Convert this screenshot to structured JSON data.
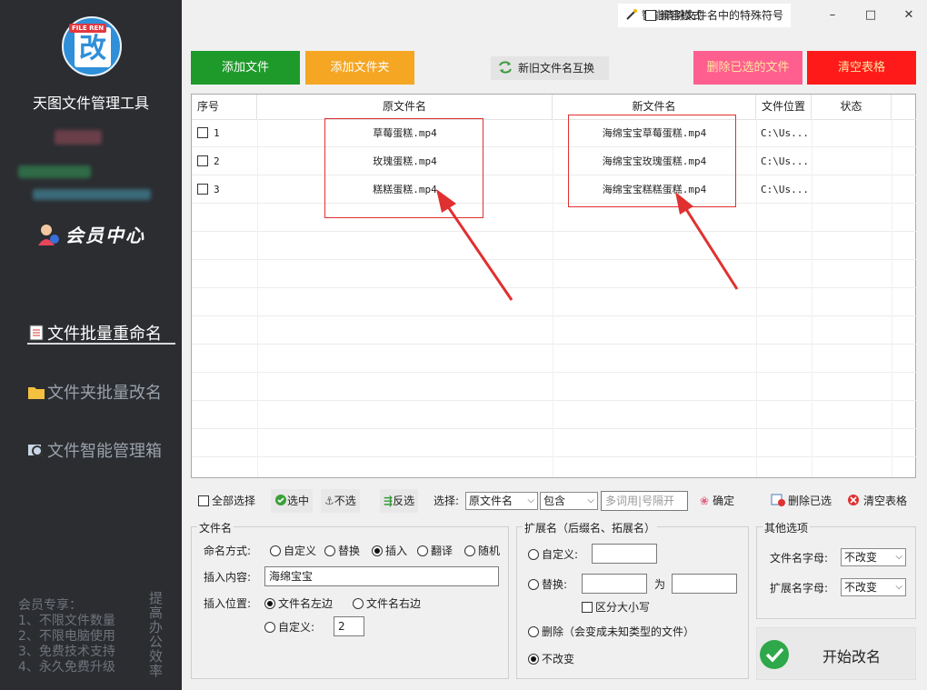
{
  "sidebar": {
    "app_title": "天图文件管理工具",
    "logo_tag": "FILE REN",
    "logo_char": "改",
    "member_center": "会员中心",
    "nav": [
      {
        "label": "文件批量重命名",
        "active": true
      },
      {
        "label": "文件夹批量改名",
        "active": false
      },
      {
        "label": "文件智能管理箱",
        "active": false
      }
    ],
    "perks": [
      "会员专享：",
      "1、不限文件数量",
      "2、不限电脑使用",
      "3、免费技术支持",
      "4、永久免费升级"
    ],
    "perks_vertical": "提高办公效率"
  },
  "titlebar": {
    "promo": "智能清除文件名中的特殊符号",
    "compat_mode": "兼容模式",
    "minimize": "–",
    "maximize": "□",
    "close": "✕"
  },
  "actions": {
    "add_file": "添加文件",
    "add_folder": "添加文件夹",
    "swap_names": "新旧文件名互换",
    "delete_selected": "删除已选的文件",
    "clear_table": "清空表格"
  },
  "table": {
    "headers": [
      "序号",
      "原文件名",
      "新文件名",
      "文件位置",
      "状态"
    ],
    "rows": [
      {
        "index": "1",
        "original": "草莓蛋糕.mp4",
        "new": "海绵宝宝草莓蛋糕.mp4",
        "location": "C:\\Us...",
        "status": ""
      },
      {
        "index": "2",
        "original": "玫瑰蛋糕.mp4",
        "new": "海绵宝宝玫瑰蛋糕.mp4",
        "location": "C:\\Us...",
        "status": ""
      },
      {
        "index": "3",
        "original": "糕糕蛋糕.mp4",
        "new": "海绵宝宝糕糕蛋糕.mp4",
        "location": "C:\\Us...",
        "status": ""
      }
    ]
  },
  "selection_bar": {
    "select_all": "全部选择",
    "select": "选中",
    "unselect": "不选",
    "invert": "反选",
    "filter_label": "选择:",
    "filter_field": "原文件名",
    "filter_mode": "包含",
    "filter_placeholder": "多词用|号隔开",
    "confirm": "确定",
    "delete_selected": "删除已选",
    "clear_table": "清空表格"
  },
  "filename_group": {
    "title": "文件名",
    "naming_label": "命名方式:",
    "modes": [
      "自定义",
      "替换",
      "插入",
      "翻译",
      "随机"
    ],
    "mode_selected": "插入",
    "insert_content_label": "插入内容:",
    "insert_content_value": "海绵宝宝",
    "insert_pos_label": "插入位置:",
    "pos_left": "文件名左边",
    "pos_right": "文件名右边",
    "pos_custom": "自定义:",
    "pos_custom_value": "2",
    "pos_selected": "文件名左边"
  },
  "ext_group": {
    "title": "扩展名（后缀名、拓展名）",
    "custom": "自定义:",
    "custom_value": "",
    "replace": "替换:",
    "replace_from": "",
    "replace_to_label": "为",
    "replace_to": "",
    "case_sensitive": "区分大小写",
    "delete": "删除（会变成未知类型的文件）",
    "unchanged": "不改变",
    "selected": "不改变"
  },
  "other_group": {
    "title": "其他选项",
    "filename_case_label": "文件名字母:",
    "filename_case_value": "不改变",
    "ext_case_label": "扩展名字母:",
    "ext_case_value": "不改变"
  },
  "start_button": "开始改名",
  "colors": {
    "sidebar_bg": "#2b2d31",
    "add_file": "#1e9a2b",
    "add_folder": "#f5a623",
    "delete_selected": "#ff5f8f",
    "clear_table": "#ff1a1a",
    "annotation_red": "#e03030"
  }
}
